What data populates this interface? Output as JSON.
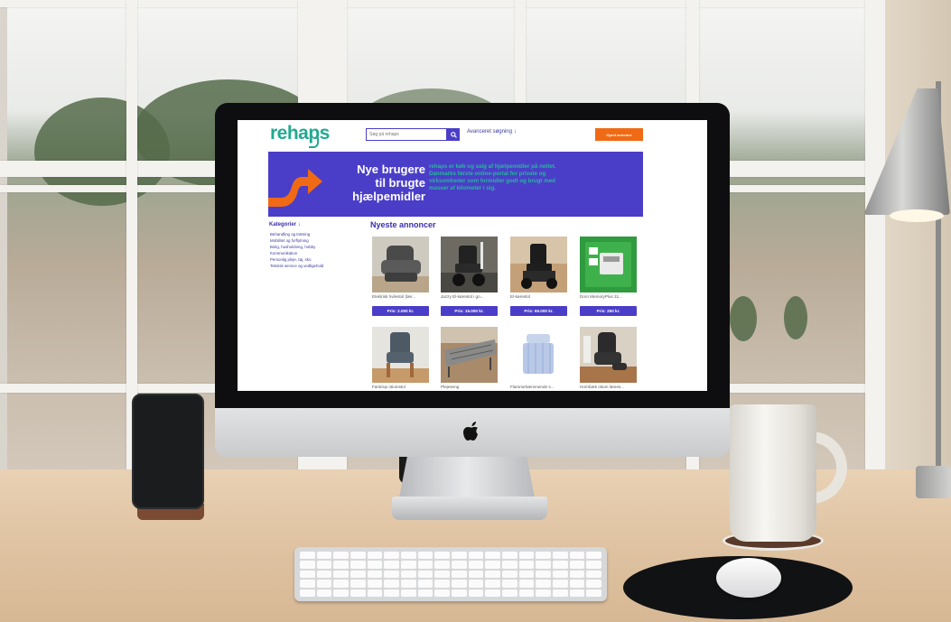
{
  "site": {
    "logo": "rehaps",
    "search": {
      "placeholder": "Søg på rehaps"
    },
    "advanced_search": "Avanceret søgning ↓",
    "create_button": "Opret annonce",
    "hero": {
      "title_lines": [
        "Nye brugere",
        "til brugte",
        "hjælpemidler"
      ],
      "text_lines": [
        "rehaps er køb og salg af hjælpemidler på nettet.",
        "Danmarks første online-portal for private og",
        "virksomheder som formidler godt og brugt med",
        "masser af kilometer i sig."
      ]
    },
    "categories": {
      "title": "Kategorier ↓",
      "items": [
        "Behandling og træning",
        "Mobilitet og forflytning",
        "Bolig, husholdning, hobby",
        "Kommunikation",
        "Personlig pleje, tøj, sko",
        "Teknisk service og vedligehold"
      ]
    },
    "section_title": "Nyeste annoncer",
    "listings": [
      {
        "title": "Elektrisk hvilestol (lær...",
        "price": "Pris: 2.000 kr."
      },
      {
        "title": "Jazzy El-kørestol i go...",
        "price": "Pris: 15.000 kr."
      },
      {
        "title": "El-kørestol",
        "price": "Pris: 65.000 kr."
      },
      {
        "title": "Doro MemoryPlus 31...",
        "price": "Pris: 250 kr."
      },
      {
        "title": "Farstrup otiumstol",
        "price": ""
      },
      {
        "title": "Plejeseng",
        "price": ""
      },
      {
        "title": "Flammehæmmende s...",
        "price": ""
      },
      {
        "title": "Hornbæk otium lænes...",
        "price": ""
      }
    ]
  },
  "colors": {
    "brand_teal": "#23a98f",
    "brand_purple": "#4a3ec8",
    "accent_orange": "#f06a15"
  },
  "icons": {
    "search": "search-icon",
    "apple": "apple-logo-icon",
    "hero_arrow": "curved-arrow-icon"
  }
}
